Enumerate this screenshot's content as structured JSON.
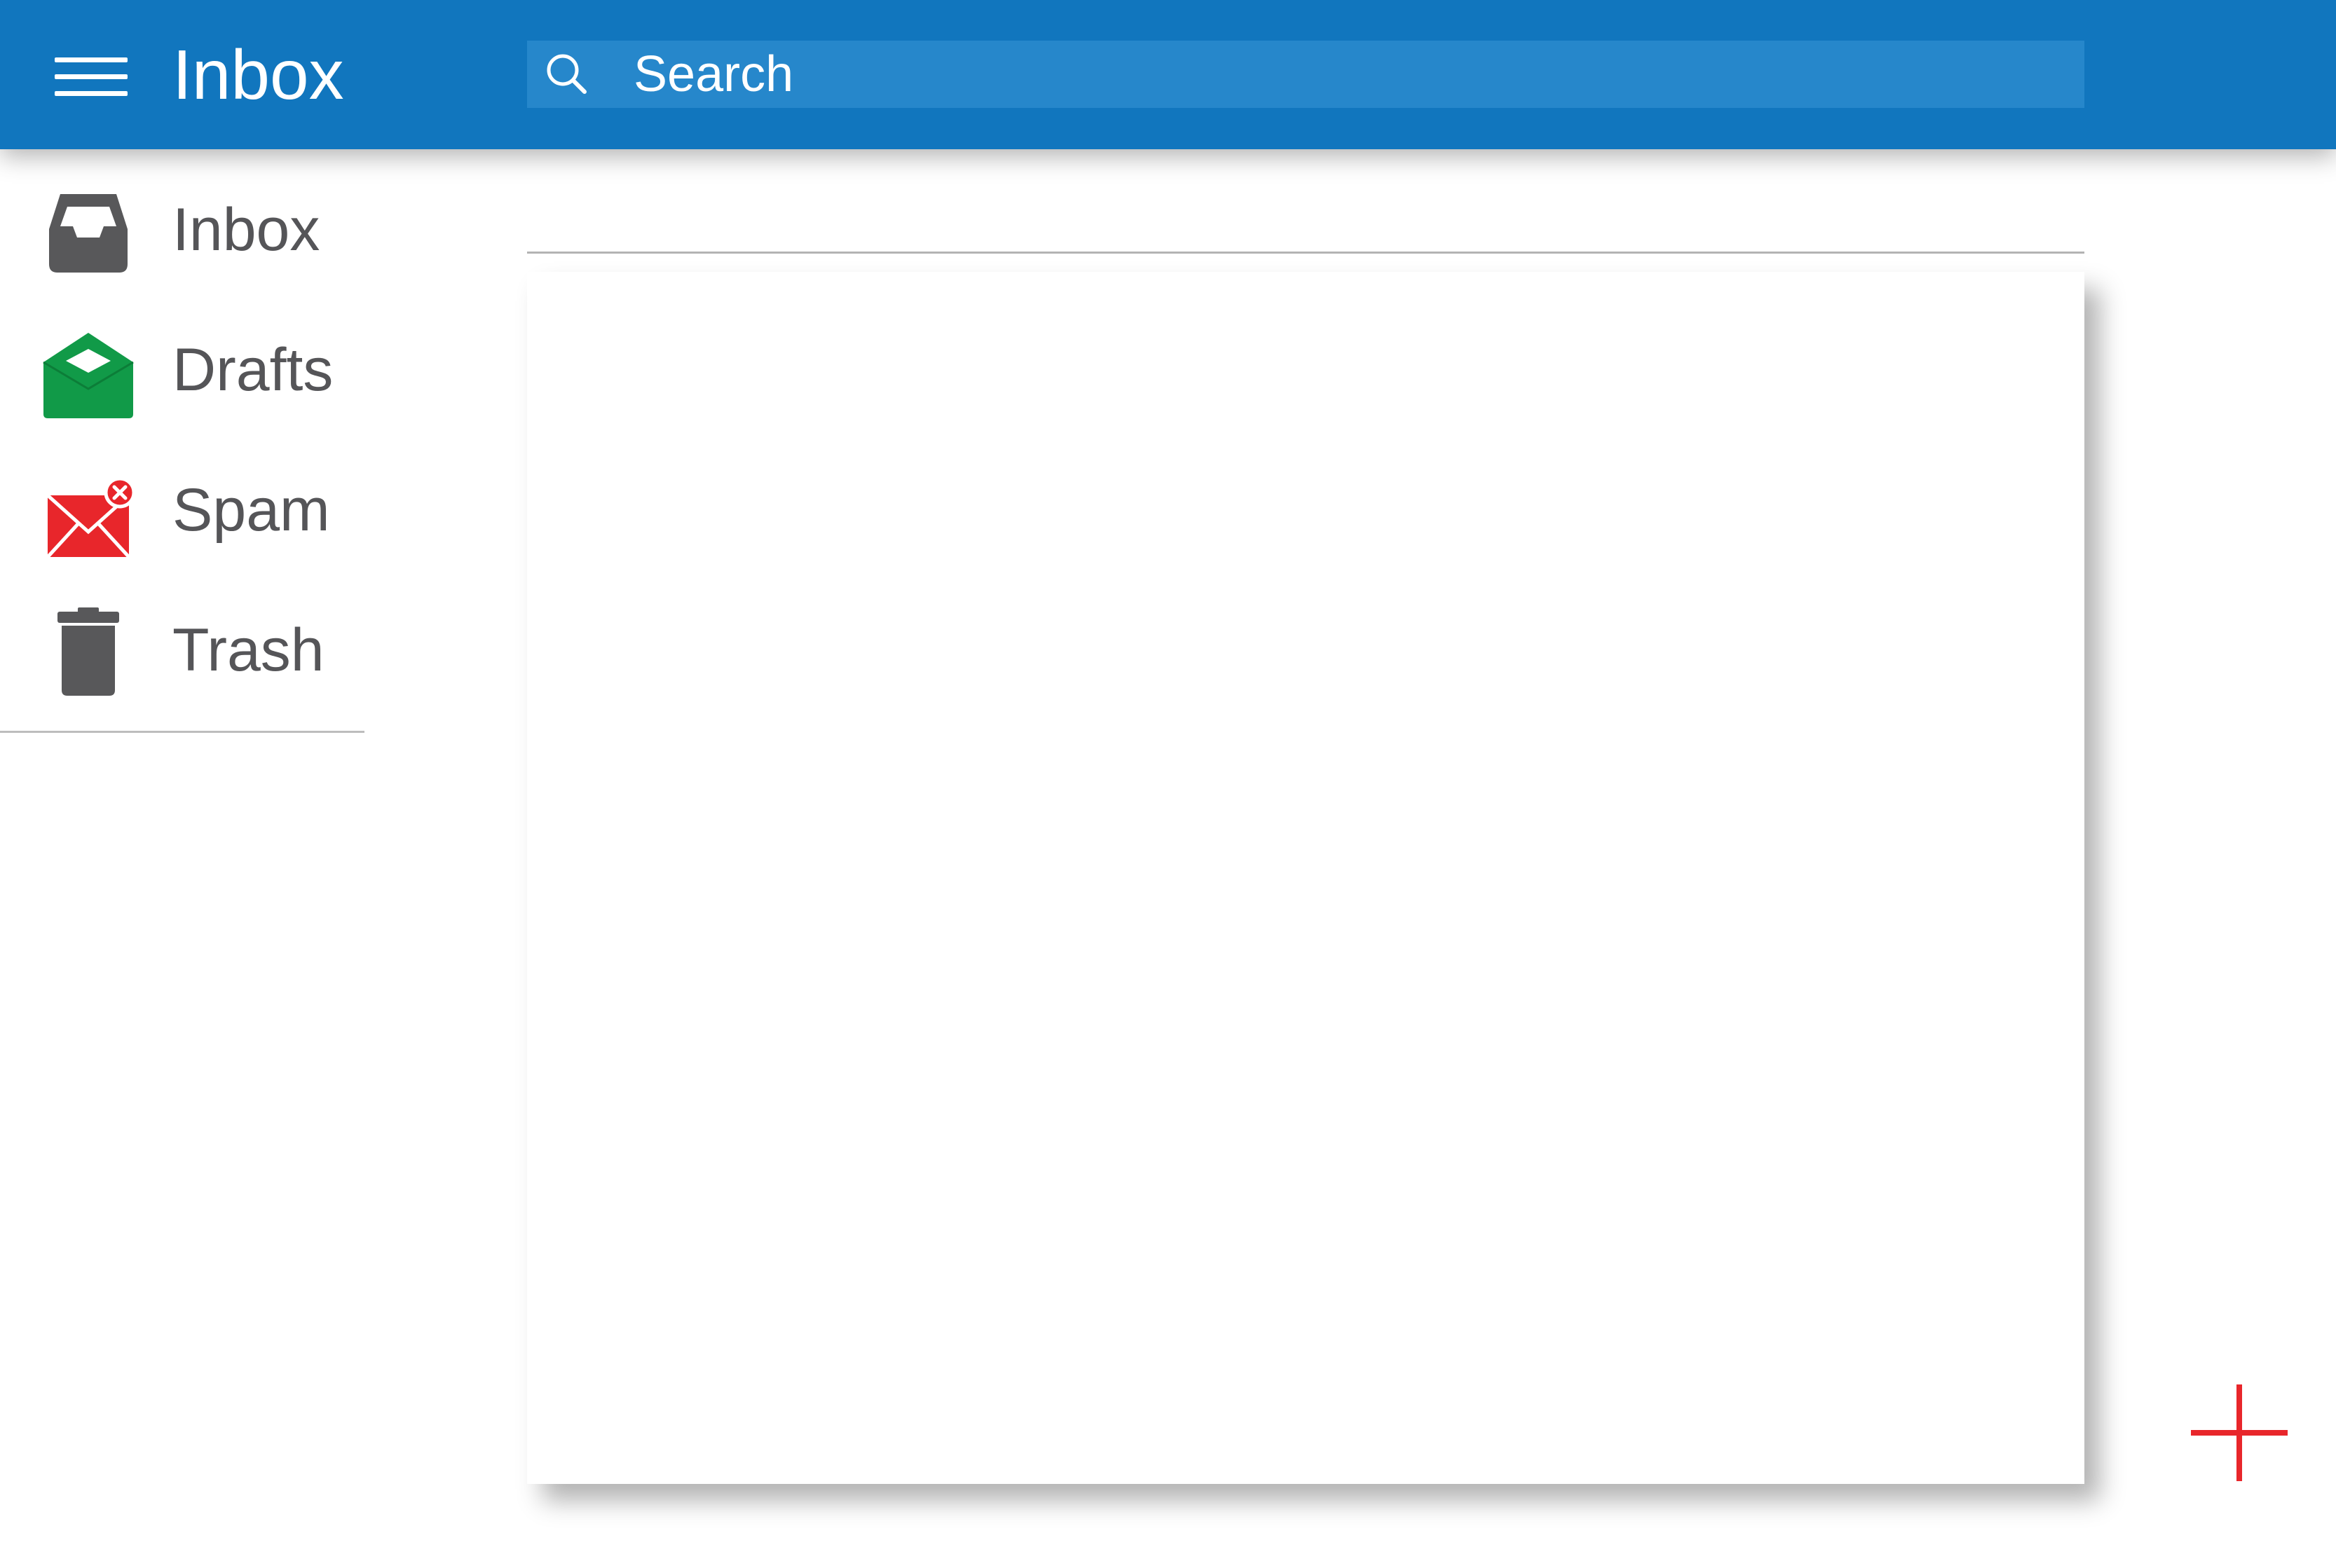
{
  "app": {
    "title": "Inbox"
  },
  "search": {
    "placeholder": "Search",
    "value": ""
  },
  "sidebar": {
    "items": [
      {
        "label": "Inbox",
        "icon": "inbox-tray-icon",
        "color": "#58585a"
      },
      {
        "label": "Drafts",
        "icon": "open-envelope-icon",
        "color": "#119a48"
      },
      {
        "label": "Spam",
        "icon": "envelope-x-badge-icon",
        "color": "#e8262b"
      },
      {
        "label": "Trash",
        "icon": "trash-can-icon",
        "color": "#58585a"
      }
    ]
  },
  "compose": {
    "icon": "plus-icon",
    "color": "#e8262b"
  },
  "colors": {
    "appbar": "#1176be",
    "search_field": "#2687cb",
    "nav_text": "#555558"
  }
}
